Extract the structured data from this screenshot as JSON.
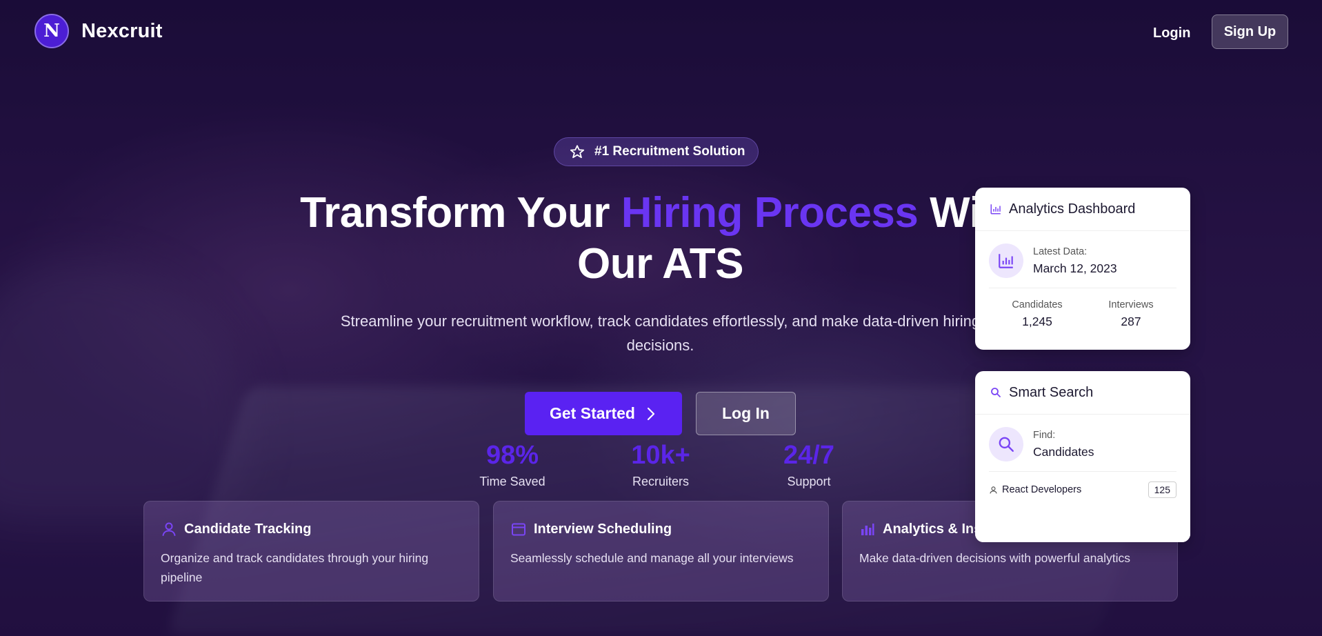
{
  "header": {
    "logo_letter": "N",
    "brand": "Nexcruit",
    "login_label": "Login",
    "signup_label": "Sign Up"
  },
  "hero": {
    "badge": "#1 Recruitment Solution",
    "headline_part1": "Transform Your ",
    "headline_highlight": "Hiring Process",
    "headline_part2": " With",
    "headline_line2": "Our ATS",
    "subtitle": "Streamline your recruitment workflow, track candidates effortlessly, and make data-driven hiring decisions.",
    "cta_primary": "Get Started",
    "cta_secondary": "Log In",
    "accent_color": "#5a22f2"
  },
  "stats": [
    {
      "value": "98%",
      "label": "Time Saved"
    },
    {
      "value": "10k+",
      "label": "Recruiters"
    },
    {
      "value": "24/7",
      "label": "Support"
    }
  ],
  "features": [
    {
      "icon": "user-icon",
      "title": "Candidate Tracking",
      "desc": "Organize and track candidates through your hiring pipeline"
    },
    {
      "icon": "calendar-icon",
      "title": "Interview Scheduling",
      "desc": "Seamlessly schedule and manage all your interviews"
    },
    {
      "icon": "chart-icon",
      "title": "Analytics & Insights",
      "desc": "Make data-driven decisions with powerful analytics"
    }
  ],
  "analytics_card": {
    "title": "Analytics Dashboard",
    "latest_label": "Latest Data:",
    "latest_value": "March 12, 2023",
    "candidates_label": "Candidates",
    "candidates_value": "1,245",
    "interviews_label": "Interviews",
    "interviews_value": "287"
  },
  "search_card": {
    "title": "Smart Search",
    "find_label": "Find:",
    "find_value": "Candidates",
    "result_label": "React Developers",
    "result_count": "125"
  }
}
